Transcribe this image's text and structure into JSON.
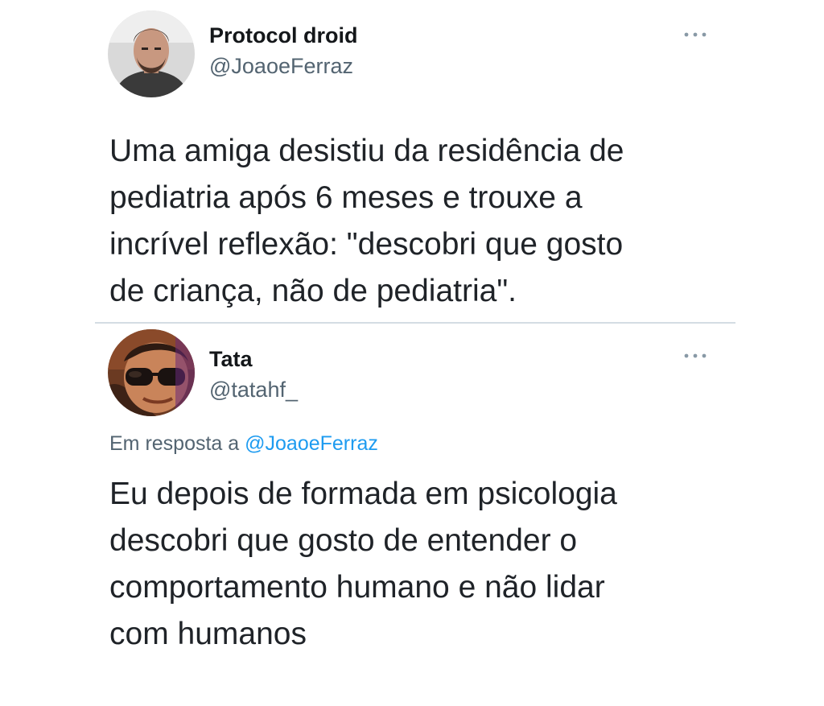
{
  "tweets": [
    {
      "display_name": "Protocol droid",
      "handle": "@JoaoeFerraz",
      "text": "Uma amiga desistiu da residência de\npediatria após 6 meses e trouxe a\nincrível reflexão: \"descobri que gosto\nde criança, não de pediatria\".",
      "avatar_icon": "profile-photo-man",
      "more_icon": "more-options-icon"
    },
    {
      "display_name": "Tata",
      "handle": "@tatahf_",
      "reply_prefix": "Em resposta a",
      "reply_to": "@JoaoeFerraz",
      "text": "Eu depois de formada em psicologia\ndescobri que gosto de entender o\ncomportamento humano e não lidar\ncom humanos",
      "avatar_icon": "profile-photo-woman-sunglasses",
      "more_icon": "more-options-icon"
    }
  ],
  "colors": {
    "text": "#1f2328",
    "secondary": "#536471",
    "link": "#1d9bf0",
    "divider": "#d4dde3"
  }
}
